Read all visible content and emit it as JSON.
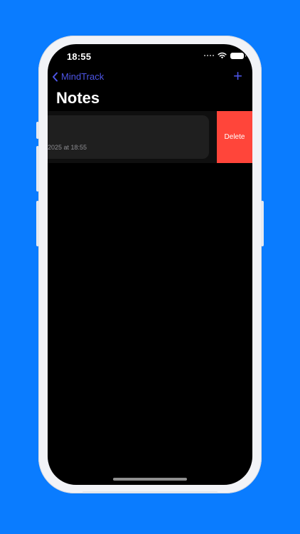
{
  "status_bar": {
    "time": "18:55",
    "wifi_icon": "wifi-icon",
    "battery_icon": "battery-icon"
  },
  "nav": {
    "back_label": "MindTrack",
    "back_icon": "chevron-left-icon",
    "add_icon": "plus-icon",
    "add_symbol": "+",
    "title": "Notes"
  },
  "notes": [
    {
      "date": "2025 at 18:55",
      "swipe_action": "Delete"
    }
  ],
  "colors": {
    "background": "#0a7cff",
    "accent": "#4d55e6",
    "delete": "#ff453a",
    "cell": "#1f1f1f"
  }
}
